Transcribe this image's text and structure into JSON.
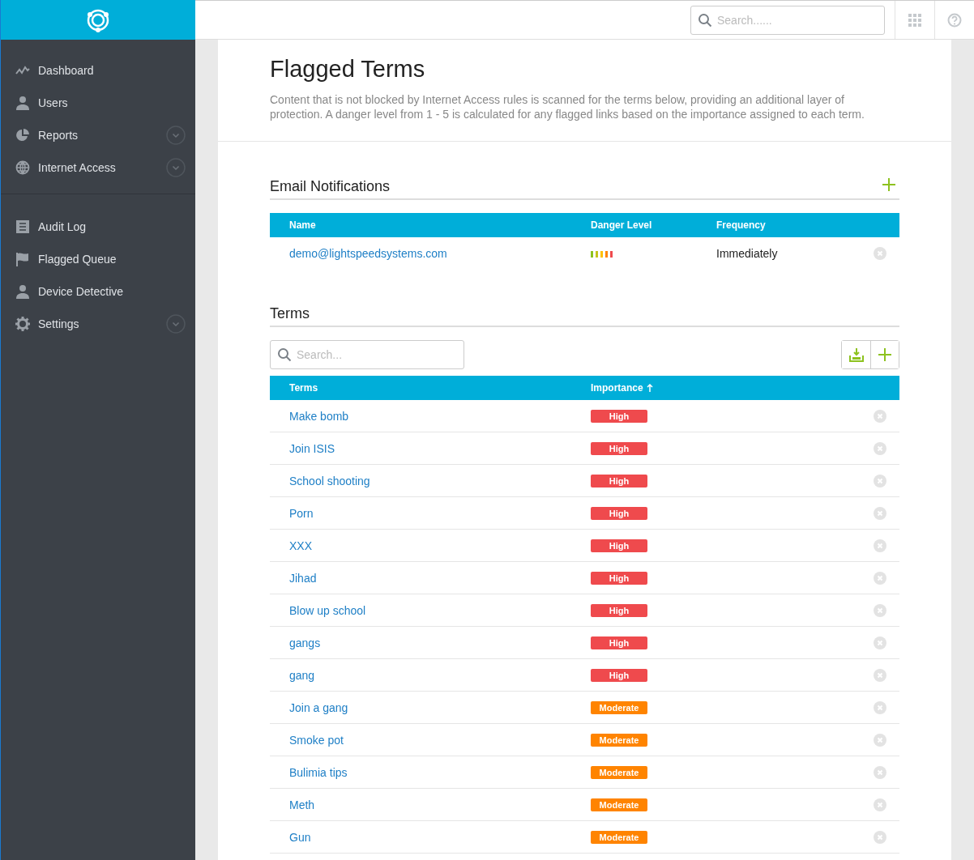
{
  "topbar": {
    "search": {
      "placeholder": "Search......"
    }
  },
  "sidebar": {
    "sections": [
      {
        "items": [
          {
            "label": "Dashboard",
            "expandable": false
          },
          {
            "label": "Users",
            "expandable": false
          },
          {
            "label": "Reports",
            "expandable": true
          },
          {
            "label": "Internet Access",
            "expandable": true
          }
        ]
      },
      {
        "items": [
          {
            "label": "Audit Log",
            "expandable": false
          },
          {
            "label": "Flagged Queue",
            "expandable": false
          },
          {
            "label": "Device Detective",
            "expandable": false
          },
          {
            "label": "Settings",
            "expandable": true
          }
        ]
      }
    ]
  },
  "page": {
    "title": "Flagged Terms",
    "description": "Content that is not blocked by Internet Access rules is scanned for the terms below, providing an additional layer of protection. A danger level from 1 - 5 is calculated for any flagged links based on the importance assigned to each term."
  },
  "email_notifications": {
    "heading": "Email Notifications",
    "columns": [
      "Name",
      "Danger Level",
      "Frequency"
    ],
    "rows": [
      {
        "name": "demo@lightspeedsystems.com",
        "frequency": "Immediately"
      }
    ]
  },
  "terms": {
    "heading": "Terms",
    "search": {
      "placeholder": "Search..."
    },
    "columns": [
      "Terms",
      "Importance"
    ],
    "rows": [
      {
        "term": "Make bomb",
        "kind": "high",
        "label": "High"
      },
      {
        "term": "Join ISIS",
        "kind": "high",
        "label": "High"
      },
      {
        "term": "School shooting",
        "kind": "high",
        "label": "High"
      },
      {
        "term": "Porn",
        "kind": "high",
        "label": "High"
      },
      {
        "term": "XXX",
        "kind": "high",
        "label": "High"
      },
      {
        "term": "Jihad",
        "kind": "high",
        "label": "High"
      },
      {
        "term": "Blow up school",
        "kind": "high",
        "label": "High"
      },
      {
        "term": "gangs",
        "kind": "high",
        "label": "High"
      },
      {
        "term": "gang",
        "kind": "high",
        "label": "High"
      },
      {
        "term": "Join a gang",
        "kind": "moderate",
        "label": "Moderate"
      },
      {
        "term": "Smoke pot",
        "kind": "moderate",
        "label": "Moderate"
      },
      {
        "term": "Bulimia tips",
        "kind": "moderate",
        "label": "Moderate"
      },
      {
        "term": "Meth",
        "kind": "moderate",
        "label": "Moderate"
      },
      {
        "term": "Gun",
        "kind": "moderate",
        "label": "Moderate"
      }
    ]
  }
}
